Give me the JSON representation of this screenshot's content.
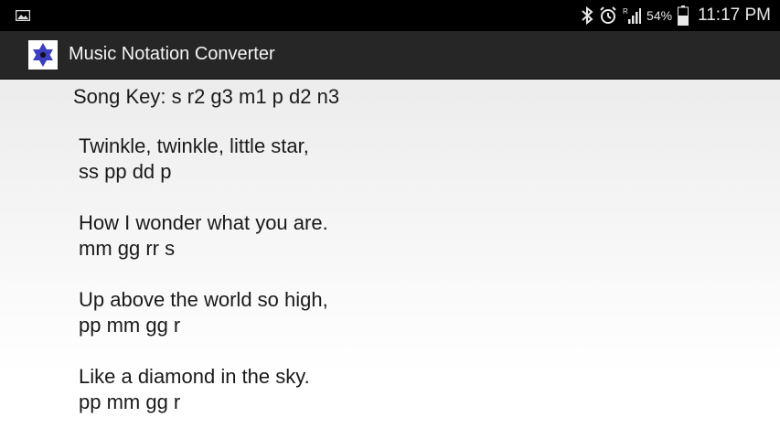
{
  "status_bar": {
    "battery_percent": "54%",
    "time": "11:17 PM",
    "icons": [
      "gallery-notification-icon",
      "bluetooth-icon",
      "alarm-icon",
      "signal-icon",
      "battery-icon"
    ]
  },
  "action_bar": {
    "title": "Music Notation Converter",
    "icon": "star-of-david-icon"
  },
  "content": {
    "song_key": "Song Key: s r2 g3 m1 p d2 n3",
    "verses": [
      {
        "lyric": "Twinkle, twinkle, little star,",
        "notes": "ss pp dd p"
      },
      {
        "lyric": "How I wonder what you are.",
        "notes": "mm gg rr s"
      },
      {
        "lyric": "Up above the world so high,",
        "notes": "pp mm gg r"
      },
      {
        "lyric": "Like a diamond in the sky.",
        "notes": "pp mm gg r"
      }
    ]
  }
}
